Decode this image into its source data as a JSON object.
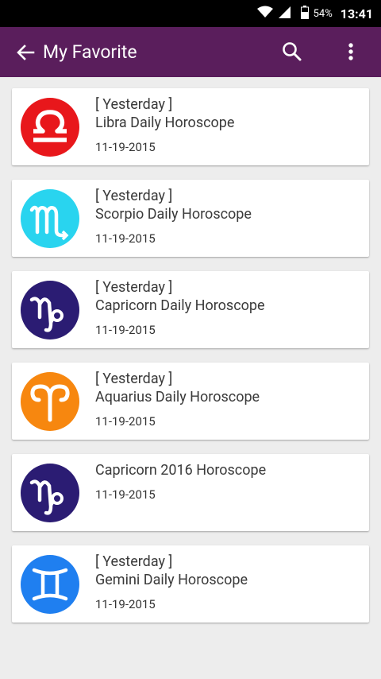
{
  "status_bar": {
    "battery": "54%",
    "time": "13:41"
  },
  "app_bar": {
    "title": "My Favorite",
    "back_icon": "arrow-left-icon",
    "search_icon": "search-icon",
    "more_icon": "more-vert-icon",
    "color": "#5a1e5c"
  },
  "favorites": [
    {
      "tag": "[ Yesterday ]",
      "title": "Libra Daily Horoscope",
      "date": "11-19-2015",
      "sign": "libra-icon",
      "color": "#e8171b"
    },
    {
      "tag": "[ Yesterday ]",
      "title": "Scorpio Daily Horoscope",
      "date": "11-19-2015",
      "sign": "scorpio-icon",
      "color": "#29d4ef"
    },
    {
      "tag": "[ Yesterday ]",
      "title": "Capricorn Daily Horoscope",
      "date": "11-19-2015",
      "sign": "capricorn-icon",
      "color": "#2b1c73"
    },
    {
      "tag": "[ Yesterday ]",
      "title": "Aquarius Daily Horoscope",
      "date": "11-19-2015",
      "sign": "aries-icon",
      "color": "#f7870f"
    },
    {
      "title": "Capricorn 2016 Horoscope",
      "date": "11-19-2015",
      "sign": "capricorn-icon",
      "color": "#2b1c73"
    },
    {
      "tag": "[ Yesterday ]",
      "title": "Gemini Daily Horoscope",
      "date": "11-19-2015",
      "sign": "gemini-icon",
      "color": "#1f7ff0"
    }
  ]
}
